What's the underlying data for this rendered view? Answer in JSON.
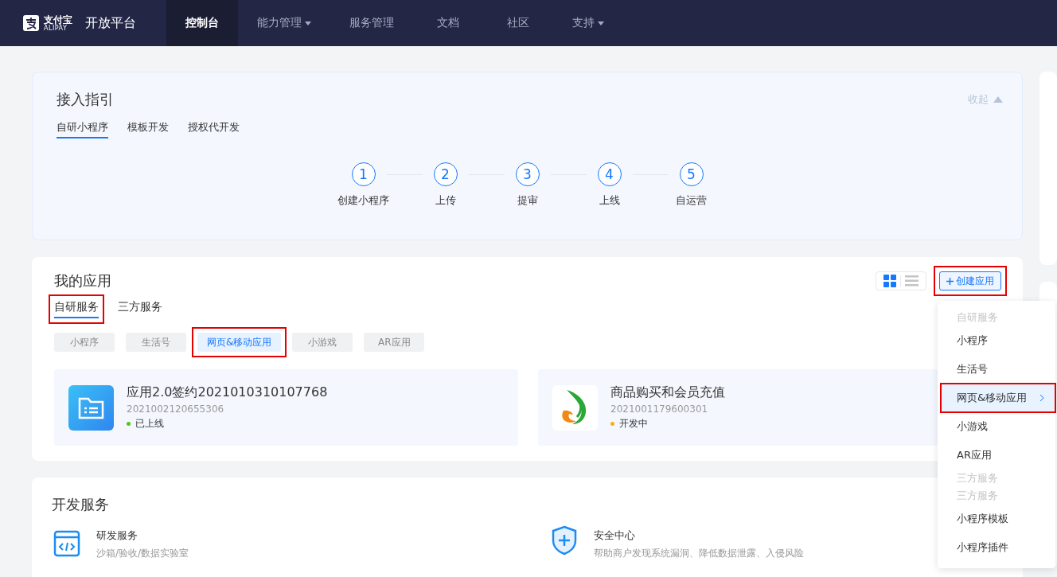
{
  "nav": {
    "brand": "支付宝",
    "brand_sub": "ALIPAY",
    "title": "开放平台",
    "items": [
      {
        "label": "控制台",
        "selected": true,
        "has_menu": false
      },
      {
        "label": "能力管理",
        "selected": false,
        "has_menu": true
      },
      {
        "label": "服务管理",
        "selected": false,
        "has_menu": false
      },
      {
        "label": "文档",
        "selected": false,
        "has_menu": false
      },
      {
        "label": "社区",
        "selected": false,
        "has_menu": false
      },
      {
        "label": "支持",
        "selected": false,
        "has_menu": true
      }
    ]
  },
  "guide": {
    "title": "接入指引",
    "collapse": "收起",
    "tabs": [
      {
        "label": "自研小程序",
        "selected": true
      },
      {
        "label": "模板开发",
        "selected": false
      },
      {
        "label": "授权代开发",
        "selected": false
      }
    ],
    "steps": [
      {
        "number": "1",
        "label": "创建小程序"
      },
      {
        "number": "2",
        "label": "上传"
      },
      {
        "number": "3",
        "label": "提审"
      },
      {
        "number": "4",
        "label": "上线"
      },
      {
        "number": "5",
        "label": "自运营"
      }
    ]
  },
  "my_apps": {
    "title": "我的应用",
    "view_toggle": [
      {
        "kind": "grid",
        "selected": true
      },
      {
        "kind": "list",
        "selected": false
      }
    ],
    "create_button": {
      "label": "创建应用",
      "highlighted": true
    },
    "tabs": [
      {
        "label": "自研服务",
        "selected": true,
        "highlighted": true
      },
      {
        "label": "三方服务",
        "selected": false,
        "highlighted": false
      }
    ],
    "filters": [
      {
        "label": "小程序",
        "selected": false,
        "highlighted": false
      },
      {
        "label": "生活号",
        "selected": false,
        "highlighted": false
      },
      {
        "label": "网页&移动应用",
        "selected": true,
        "highlighted": true
      },
      {
        "label": "小游戏",
        "selected": false,
        "highlighted": false
      },
      {
        "label": "AR应用",
        "selected": false,
        "highlighted": false
      }
    ],
    "apps": [
      {
        "kind": "folder",
        "name": "应用2.0签约2021010310107768",
        "id": "2021002120655306",
        "status": "已上线",
        "color": "#52c41a"
      },
      {
        "kind": "leaf",
        "name": "商品购买和会员充值",
        "id": "2021001179600301",
        "status": "开发中",
        "color": "#faad14"
      }
    ]
  },
  "dev_services": {
    "title": "开发服务",
    "items": [
      {
        "kind": "code",
        "title": "研发服务",
        "desc": "沙箱/验收/数据实验室"
      },
      {
        "kind": "shield",
        "title": "安全中心",
        "desc": "帮助商户发现系统漏洞、降低数据泄露、入侵风险"
      }
    ]
  },
  "create_menu": {
    "items": [
      {
        "kind": "header",
        "label": "自研服务"
      },
      {
        "kind": "item",
        "label": "小程序",
        "selected": false,
        "highlighted": false,
        "has_submenu": false
      },
      {
        "kind": "item",
        "label": "生活号",
        "selected": false,
        "highlighted": false,
        "has_submenu": false
      },
      {
        "kind": "item",
        "label": "网页&移动应用",
        "selected": true,
        "highlighted": true,
        "has_submenu": true
      },
      {
        "kind": "item",
        "label": "小游戏",
        "selected": false,
        "highlighted": false,
        "has_submenu": false
      },
      {
        "kind": "item",
        "label": "AR应用",
        "selected": false,
        "highlighted": false,
        "has_submenu": false
      },
      {
        "kind": "header",
        "label": "三方服务"
      },
      {
        "kind": "header",
        "label": "三方服务"
      },
      {
        "kind": "item",
        "label": "小程序模板",
        "selected": false,
        "highlighted": false,
        "has_submenu": false
      },
      {
        "kind": "item",
        "label": "小程序插件",
        "selected": false,
        "highlighted": false,
        "has_submenu": false
      }
    ]
  }
}
